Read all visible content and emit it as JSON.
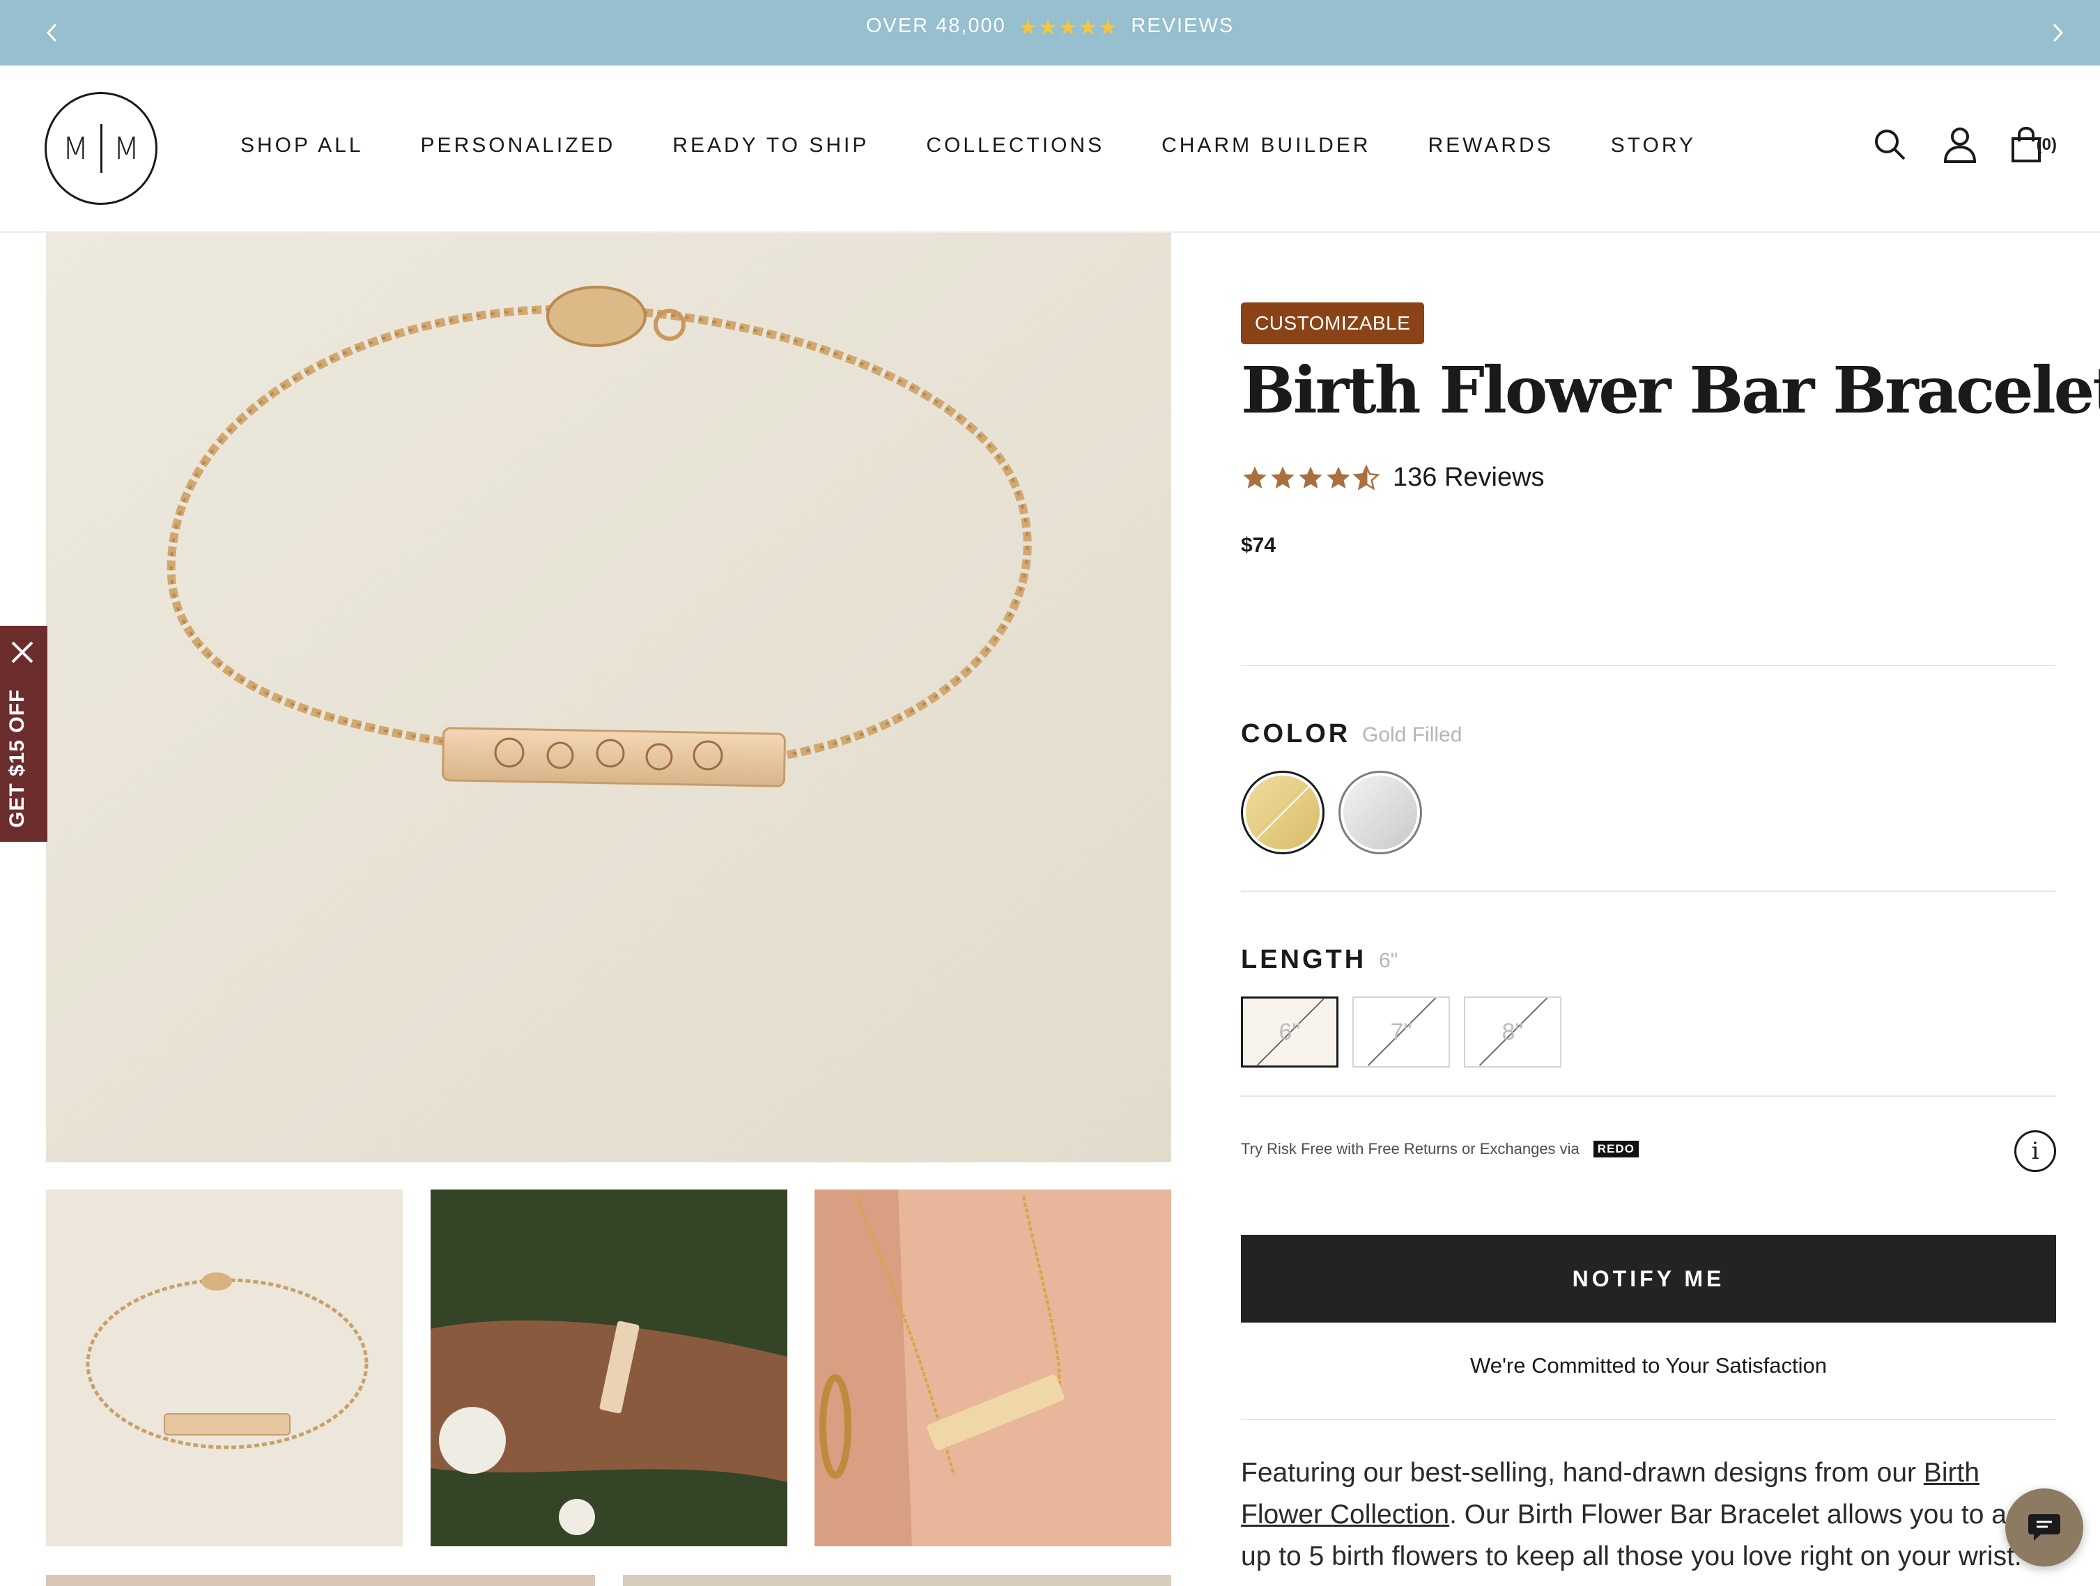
{
  "announcement": {
    "prefix": "OVER 48,000",
    "suffix": "REVIEWS",
    "stars": 5
  },
  "header": {
    "logo_left": "M",
    "logo_right": "M",
    "nav": [
      "SHOP ALL",
      "PERSONALIZED",
      "READY TO SHIP",
      "COLLECTIONS",
      "CHARM BUILDER",
      "REWARDS",
      "STORY"
    ],
    "cart_count": "(0)",
    "icons": [
      "search-icon",
      "account-icon",
      "cart-icon"
    ]
  },
  "promo": {
    "label": "GET $15 OFF"
  },
  "product": {
    "badge": "CUSTOMIZABLE",
    "title": "Birth Flower Bar Bracelet",
    "rating": 4.5,
    "reviews": "136 Reviews",
    "price": "$74",
    "color_label": "COLOR",
    "color_value": "Gold Filled",
    "colors": [
      {
        "name": "Gold Filled",
        "hex": "#e2c87d",
        "selected": true
      },
      {
        "name": "Sterling Silver",
        "hex": "#d9d9d9",
        "selected": false
      }
    ],
    "length_label": "LENGTH",
    "length_value": "6\"",
    "lengths": [
      "6\"",
      "7\"",
      "8\""
    ],
    "returns_text": "Try Risk Free with Free Returns or Exchanges via",
    "returns_brand": "REDO",
    "notify_button": "NOTIFY ME",
    "commitment": "We're Committed to Your Satisfaction",
    "desc_1": "Featuring our best-selling, hand-drawn designs from our ",
    "desc_link": "Birth Flower Collection",
    "desc_2": ". Our Birth Flower Bar Bracelet allows you to add up to 5 birth flowers to keep all those you love right on your wrist."
  },
  "colors": {
    "announcement_bg": "#96bfcf",
    "badge_bg": "#8a4316",
    "star": "#a9703f",
    "promo_bg": "#6c2d2d",
    "button_bg": "#222424",
    "chat_bg": "#8c7a62"
  }
}
